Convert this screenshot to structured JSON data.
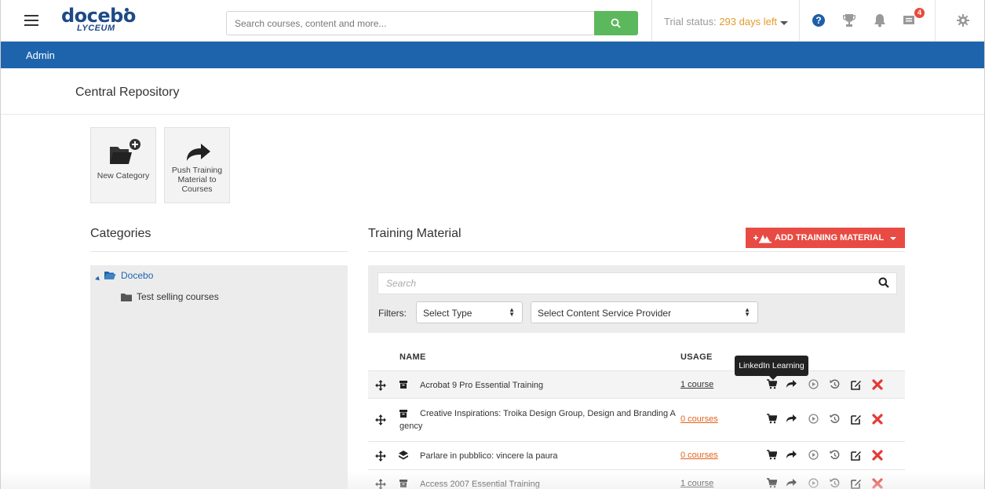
{
  "header": {
    "logo_main": "docebo",
    "logo_sub": "LYCEUM",
    "search_placeholder": "Search courses, content and more...",
    "trial_prefix": "Trial status: ",
    "trial_days": "293 days left",
    "help_glyph": "?",
    "inbox_count": "4",
    "icons": [
      "menu-icon",
      "search-icon",
      "help-icon",
      "trophy-icon",
      "bell-icon",
      "inbox-icon",
      "gear-icon"
    ]
  },
  "adminbar": {
    "label": "Admin"
  },
  "page": {
    "title": "Central Repository"
  },
  "tiles": {
    "new_category": "New Category",
    "push_training": "Push Training Material to Courses"
  },
  "categories": {
    "heading": "Categories",
    "root": "Docebo",
    "child": "Test selling courses"
  },
  "training": {
    "heading": "Training Material",
    "add_label": "ADD TRAINING MATERIAL",
    "search_placeholder": "Search",
    "filters_label": "Filters:",
    "select_type": "Select Type",
    "select_provider": "Select Content Service Provider",
    "col_name": "NAME",
    "col_usage": "USAGE",
    "tooltip": "LinkedIn Learning",
    "rows": [
      {
        "name": "Acrobat 9 Pro Essential Training",
        "usage": "1 course",
        "type": "archive"
      },
      {
        "name": "Creative Inspirations: Troika Design Group, Design and Branding A gency",
        "usage": "0 courses",
        "type": "archive"
      },
      {
        "name": "Parlare in pubblico: vincere la paura",
        "usage": "0 courses",
        "type": "layers"
      },
      {
        "name": "Access 2007 Essential Training",
        "usage": "1 course",
        "type": "archive"
      }
    ]
  },
  "colors": {
    "brand_blue": "#1e64ad",
    "logo_blue": "#1e4a86",
    "search_green": "#5cb85c",
    "add_red": "#e84b43",
    "trial_orange": "#e49b2a",
    "usage_orange": "#e2631d",
    "delete_red": "#e53935"
  }
}
